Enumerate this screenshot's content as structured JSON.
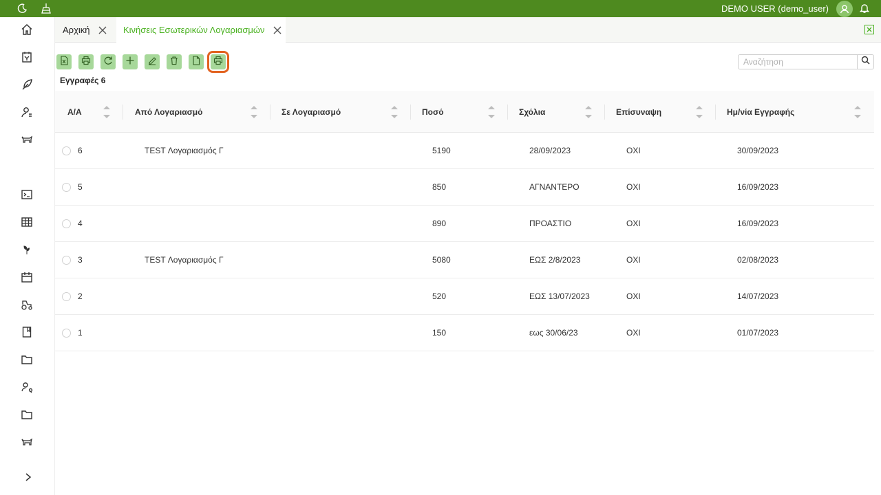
{
  "topbar": {
    "user_label": "DEMO USER (demo_user)",
    "icons": [
      "moon-icon",
      "clean-icon",
      "user-avatar-icon",
      "bell-icon"
    ]
  },
  "sidebar": {
    "items": [
      "home-icon",
      "invoice-icon",
      "feather-icon",
      "user-settings-icon",
      "cow-icon",
      "terminal-icon",
      "table-icon",
      "seedling-icon",
      "calendar-icon",
      "tractor-icon",
      "book-icon",
      "folder-icon",
      "user-search-icon",
      "folder-icon",
      "cow-icon",
      "chevron-right-icon"
    ]
  },
  "tabs": [
    {
      "label": "Αρχική",
      "active": false
    },
    {
      "label": "Κινήσεις Εσωτερικών Λογαριασμών",
      "active": true
    }
  ],
  "toolbar": {
    "buttons": [
      "excel-export-icon",
      "print-icon",
      "refresh-icon",
      "add-icon",
      "edit-icon",
      "delete-icon",
      "document-icon",
      "print-list-icon"
    ],
    "highlighted": "print-list-icon"
  },
  "records_label": "Εγγραφές 6",
  "search": {
    "placeholder": "Αναζήτηση",
    "value": ""
  },
  "table": {
    "columns": [
      "Α/Α",
      "Από Λογαριασμό",
      "Σε Λογαριασμό",
      "Ποσό",
      "Σχόλια",
      "Επίσυναψη",
      "Ημ/νία Εγγραφής"
    ],
    "rows": [
      {
        "aa": "6",
        "from": "TEST Λογαριασμός Γ",
        "to": "",
        "amount": "5190",
        "comments": "28/09/2023",
        "attachment": "ΟΧΙ",
        "date": "30/09/2023"
      },
      {
        "aa": "5",
        "from": "",
        "to": "",
        "amount": "850",
        "comments": "ΑΓΝΑΝΤΕΡΟ",
        "attachment": "ΟΧΙ",
        "date": "16/09/2023"
      },
      {
        "aa": "4",
        "from": "",
        "to": "",
        "amount": "890",
        "comments": "ΠΡΟΑΣΤΙΟ",
        "attachment": "ΟΧΙ",
        "date": "16/09/2023"
      },
      {
        "aa": "3",
        "from": "TEST Λογαριασμός Γ",
        "to": "",
        "amount": "5080",
        "comments": "ΕΩΣ 2/8/2023",
        "attachment": "ΟΧΙ",
        "date": "02/08/2023"
      },
      {
        "aa": "2",
        "from": "",
        "to": "",
        "amount": "520",
        "comments": "ΕΩΣ 13/07/2023",
        "attachment": "ΟΧΙ",
        "date": "14/07/2023"
      },
      {
        "aa": "1",
        "from": "",
        "to": "",
        "amount": "150",
        "comments": "εως 30/06/23",
        "attachment": "ΟΧΙ",
        "date": "01/07/2023"
      }
    ]
  },
  "colors": {
    "topbar": "#4e8a1f",
    "accent": "#49b11f",
    "button_bg": "#a7d89a",
    "highlight": "#e2621f"
  }
}
